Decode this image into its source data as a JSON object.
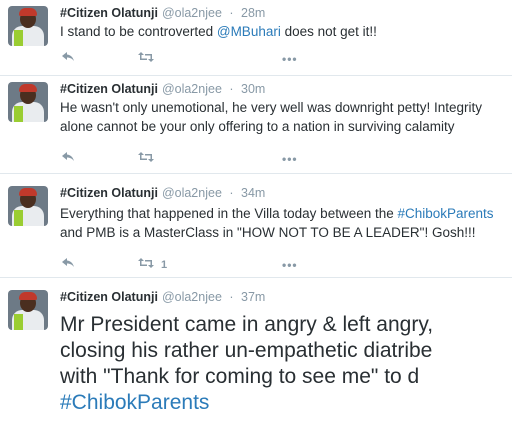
{
  "tweets": [
    {
      "name": "#Citizen Olatunji",
      "handle": "@ola2njee",
      "time": "28m",
      "text_parts": [
        "I stand to be controverted ",
        "@MBuhari",
        " does not get it!!"
      ],
      "retweet_count": ""
    },
    {
      "name": "#Citizen Olatunji",
      "handle": "@ola2njee",
      "time": "30m",
      "line1": "He wasn't only unemotional, he very well was downright petty! Integrity",
      "line2": "alone cannot be your only offering to a nation in surviving calamity",
      "retweet_count": ""
    },
    {
      "name": "#Citizen Olatunji",
      "handle": "@ola2njee",
      "time": "34m",
      "line1_a": "Everything that happened in the Villa today between the ",
      "line1_link": "#ChibokParents",
      "line2": "and PMB is a MasterClass in \"HOW NOT TO BE A LEADER\"! Gosh!!!",
      "retweet_count": "1"
    },
    {
      "name": "#Citizen Olatunji",
      "handle": "@ola2njee",
      "time": "37m",
      "line1": "Mr President came in angry & left angry,",
      "line2": "closing his rather un-empathetic diatribe",
      "line3": "with \"Thank for coming to see me\" to d",
      "line4_link": "#ChibokParents"
    }
  ],
  "colors": {
    "link": "#2b7bb9",
    "meta": "#8899a6",
    "text": "#292f33"
  },
  "icons": [
    "reply-icon",
    "retweet-icon",
    "more-icon"
  ]
}
